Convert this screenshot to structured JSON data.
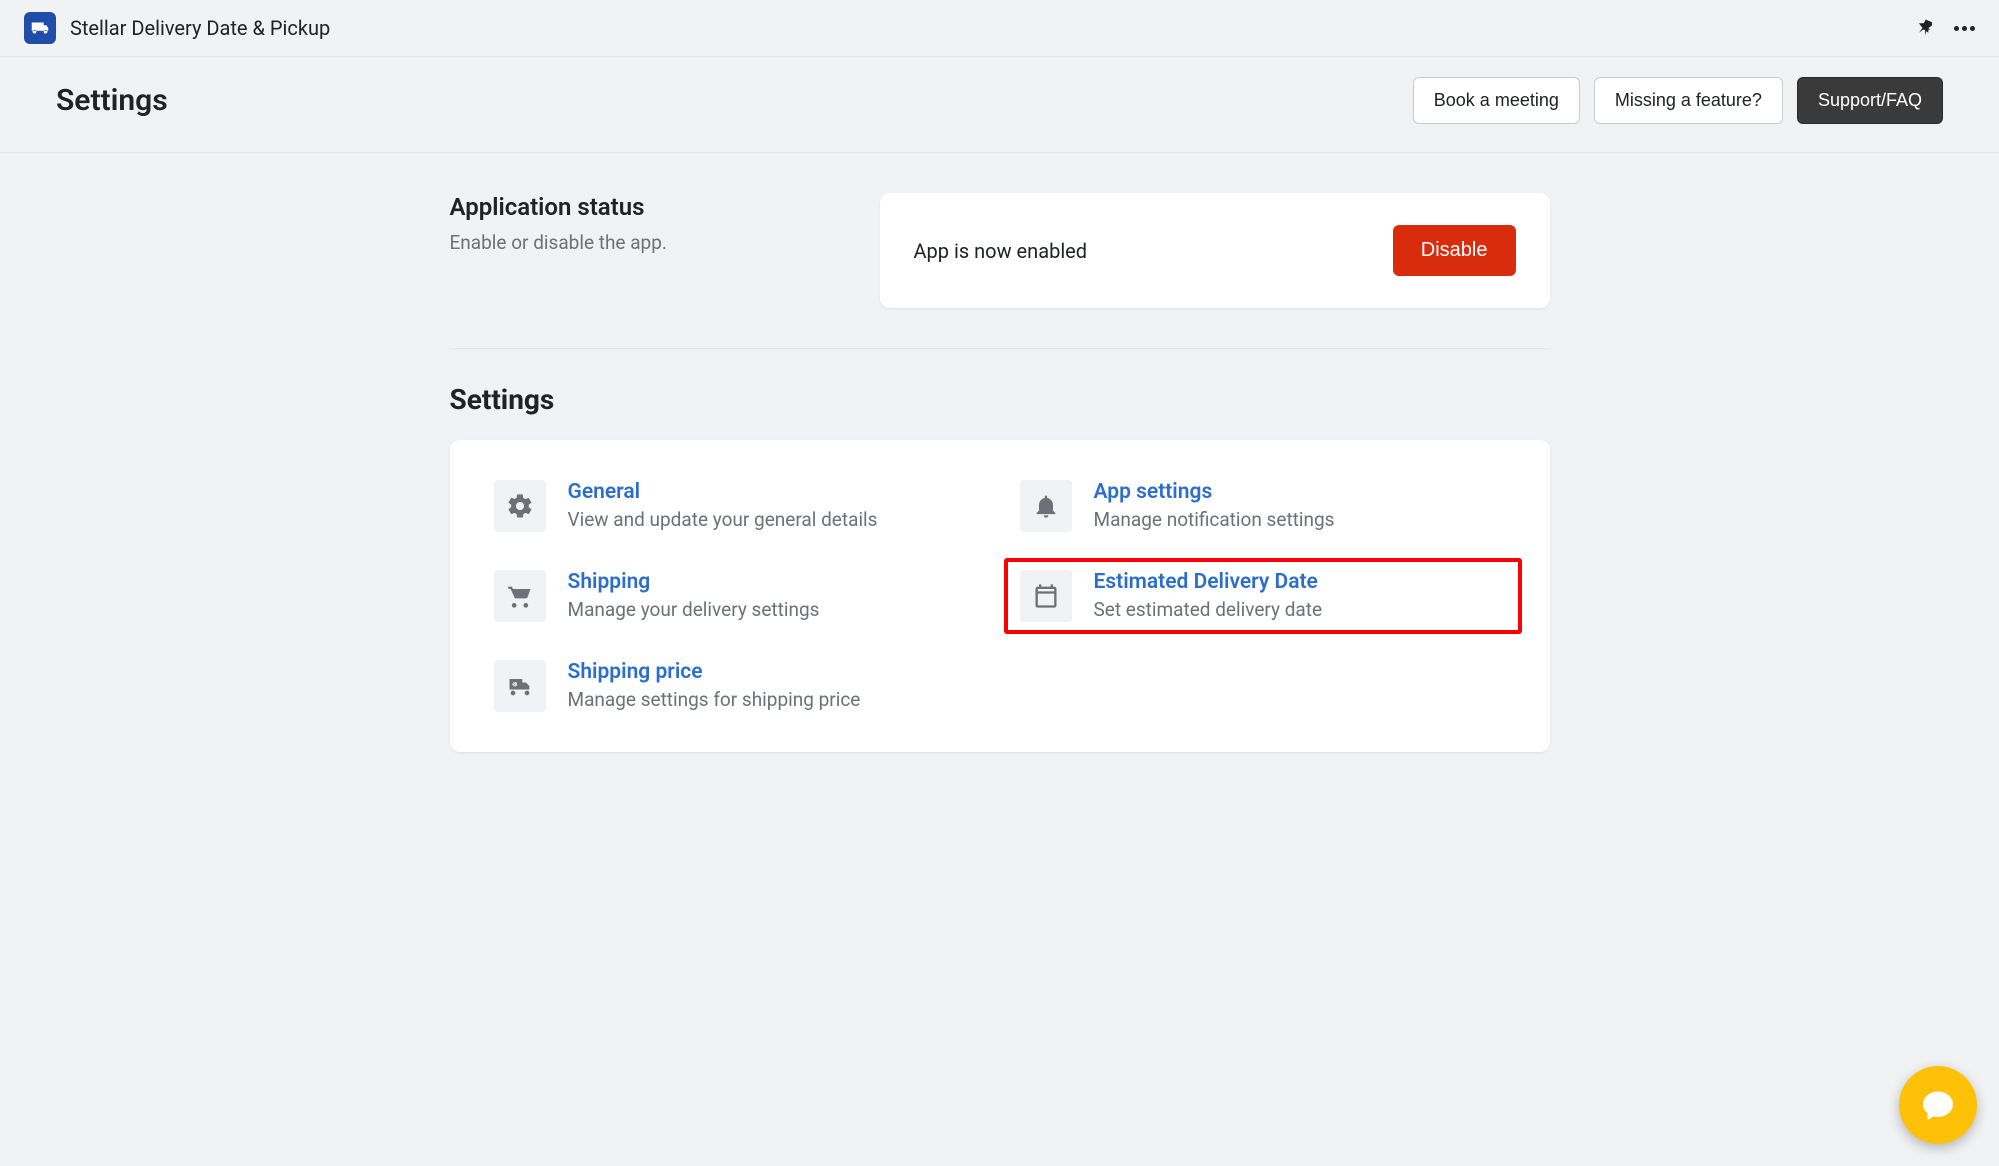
{
  "header": {
    "appName": "Stellar Delivery Date & Pickup"
  },
  "pageBar": {
    "title": "Settings",
    "buttons": {
      "bookMeeting": "Book a meeting",
      "missingFeature": "Missing a feature?",
      "supportFaq": "Support/FAQ"
    }
  },
  "status": {
    "heading": "Application status",
    "desc": "Enable or disable the app.",
    "cardText": "App is now enabled",
    "disableLabel": "Disable"
  },
  "settingsSection": {
    "heading": "Settings",
    "items": [
      {
        "title": "General",
        "desc": "View and update your general details"
      },
      {
        "title": "App settings",
        "desc": "Manage notification settings"
      },
      {
        "title": "Shipping",
        "desc": "Manage your delivery settings"
      },
      {
        "title": "Estimated Delivery Date",
        "desc": "Set estimated delivery date"
      },
      {
        "title": "Shipping price",
        "desc": "Manage settings for shipping price"
      }
    ]
  }
}
